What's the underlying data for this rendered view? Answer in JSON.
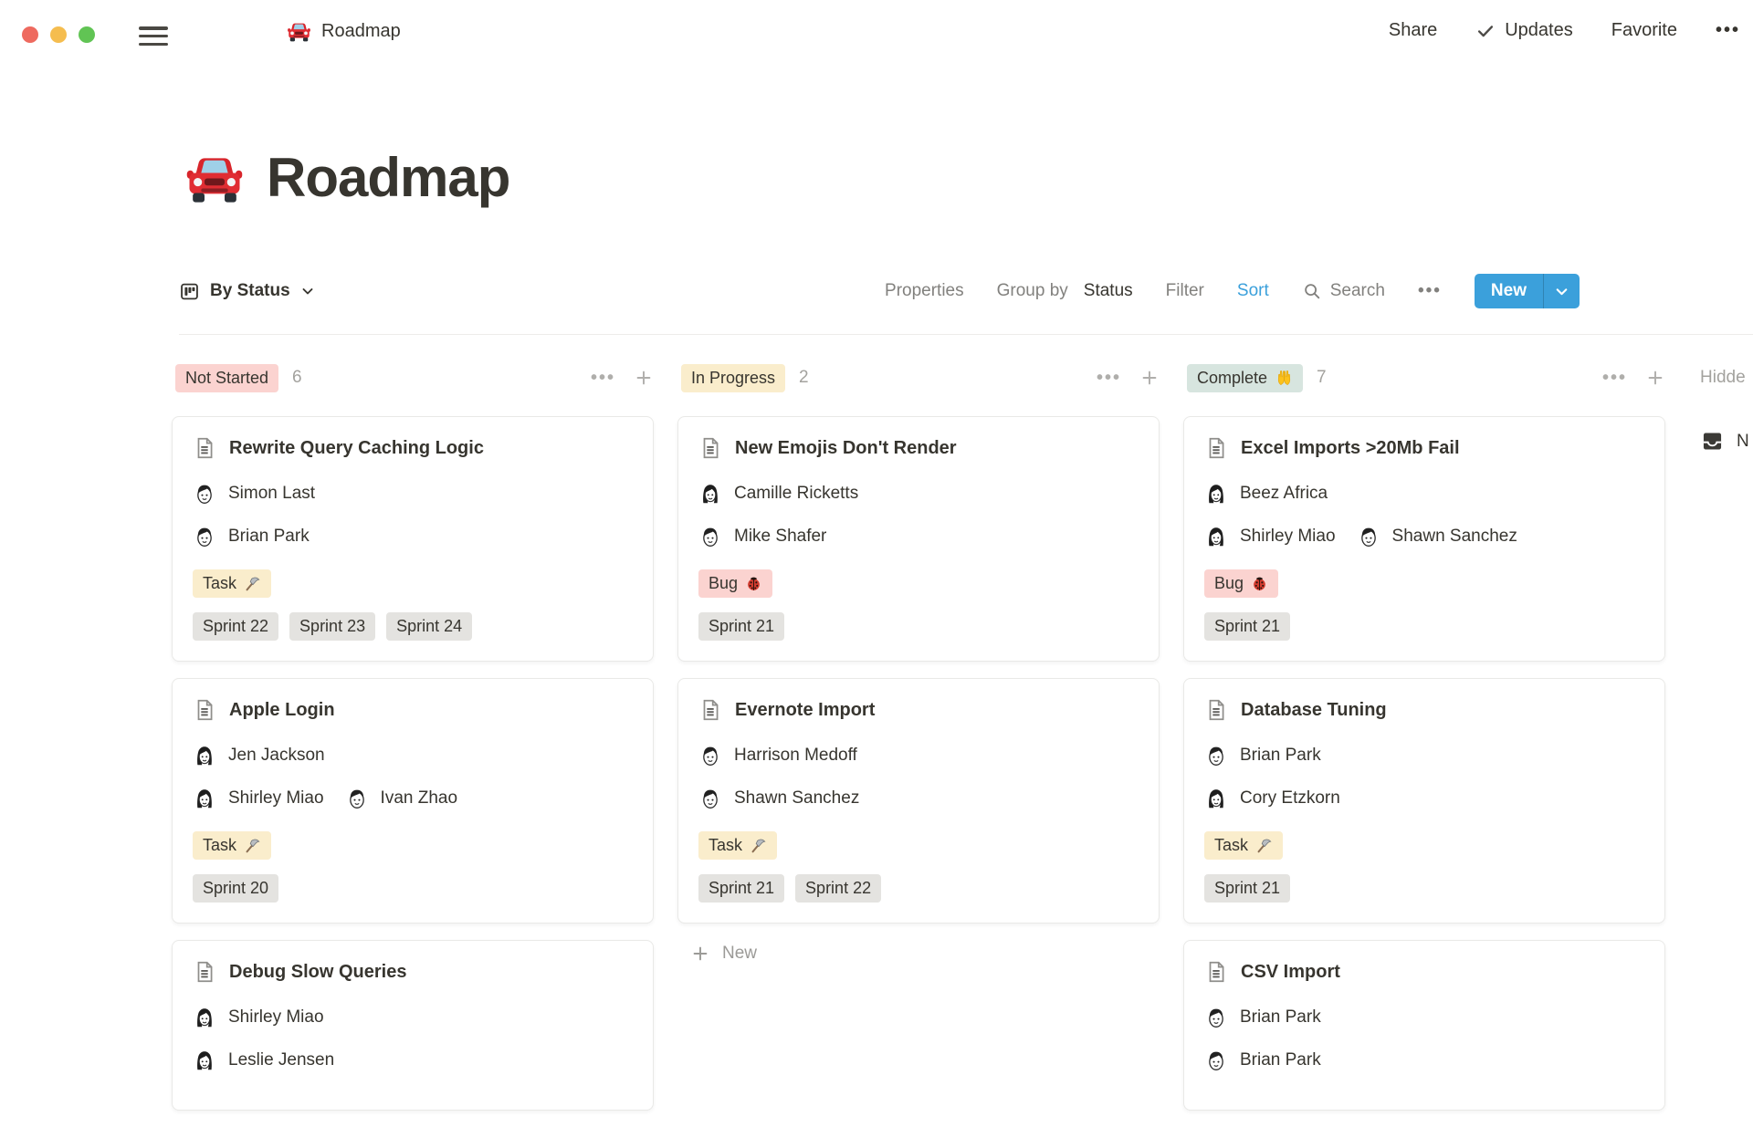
{
  "topbar": {
    "doc_title": "Roadmap",
    "doc_icon": "car-emoji",
    "share_label": "Share",
    "updates_label": "Updates",
    "favorite_label": "Favorite",
    "more_label": "•••"
  },
  "page": {
    "title": "Roadmap",
    "title_icon": "car-emoji"
  },
  "toolbar": {
    "view_label": "By Status",
    "properties_label": "Properties",
    "group_by_label": "Group by",
    "group_by_value": "Status",
    "filter_label": "Filter",
    "sort_label": "Sort",
    "search_label": "Search",
    "more_label": "•••",
    "new_label": "New"
  },
  "colors": {
    "accent_blue": "#3BA0DB",
    "status_red": "#FBD3D0",
    "status_yellow": "#FAEDCC",
    "status_green": "#D7E5DF",
    "tag_gray": "#E4E3E0"
  },
  "board": {
    "more_label": "•••",
    "columns": [
      {
        "label": "Not Started",
        "emoji": null,
        "badge_color": "#FBD3D0",
        "count": "6",
        "cards": [
          {
            "title": "Rewrite Query Caching Logic",
            "people_rows": [
              [
                {
                  "name": "Simon Last",
                  "avatar": "short-hair-avatar-icon"
                }
              ],
              [
                {
                  "name": "Brian Park",
                  "avatar": "short-hair-avatar-icon"
                }
              ]
            ],
            "tags": [
              {
                "label": "Task",
                "icon": "hammer-emoji",
                "color": "#FAEDCC"
              }
            ],
            "sprints": [
              "Sprint 22",
              "Sprint 23",
              "Sprint 24"
            ]
          },
          {
            "title": "Apple Login",
            "people_rows": [
              [
                {
                  "name": "Jen Jackson",
                  "avatar": "long-hair-avatar-icon"
                }
              ],
              [
                {
                  "name": "Shirley Miao",
                  "avatar": "long-hair-avatar-icon"
                },
                {
                  "name": "Ivan Zhao",
                  "avatar": "short-hair-avatar-icon"
                }
              ]
            ],
            "tags": [
              {
                "label": "Task",
                "icon": "hammer-emoji",
                "color": "#FAEDCC"
              }
            ],
            "sprints": [
              "Sprint 20"
            ]
          },
          {
            "title": "Debug Slow Queries",
            "people_rows": [
              [
                {
                  "name": "Shirley Miao",
                  "avatar": "long-hair-avatar-icon"
                }
              ],
              [
                {
                  "name": "Leslie Jensen",
                  "avatar": "long-hair-avatar-icon"
                }
              ]
            ],
            "tags": [],
            "sprints": []
          }
        ]
      },
      {
        "label": "In Progress",
        "emoji": null,
        "badge_color": "#FAEDCC",
        "count": "2",
        "footer_new": "New",
        "cards": [
          {
            "title": "New Emojis Don't Render",
            "people_rows": [
              [
                {
                  "name": "Camille Ricketts",
                  "avatar": "long-hair-avatar-icon"
                }
              ],
              [
                {
                  "name": "Mike Shafer",
                  "avatar": "short-hair-avatar-icon"
                }
              ]
            ],
            "tags": [
              {
                "label": "Bug",
                "icon": "ladybug-emoji",
                "color": "#FBD3D0"
              }
            ],
            "sprints": [
              "Sprint 21"
            ]
          },
          {
            "title": "Evernote Import",
            "people_rows": [
              [
                {
                  "name": "Harrison Medoff",
                  "avatar": "short-hair-avatar-icon"
                }
              ],
              [
                {
                  "name": "Shawn Sanchez",
                  "avatar": "short-hair-avatar-icon"
                }
              ]
            ],
            "tags": [
              {
                "label": "Task",
                "icon": "hammer-emoji",
                "color": "#FAEDCC"
              }
            ],
            "sprints": [
              "Sprint 21",
              "Sprint 22"
            ]
          }
        ]
      },
      {
        "label": "Complete",
        "emoji": "raised-hands-emoji",
        "badge_color": "#D7E5DF",
        "count": "7",
        "cards": [
          {
            "title": "Excel Imports >20Mb Fail",
            "people_rows": [
              [
                {
                  "name": "Beez Africa",
                  "avatar": "long-hair-avatar-icon"
                }
              ],
              [
                {
                  "name": "Shirley Miao",
                  "avatar": "long-hair-avatar-icon"
                },
                {
                  "name": "Shawn Sanchez",
                  "avatar": "short-hair-avatar-icon"
                }
              ]
            ],
            "tags": [
              {
                "label": "Bug",
                "icon": "ladybug-emoji",
                "color": "#FBD3D0"
              }
            ],
            "sprints": [
              "Sprint 21"
            ]
          },
          {
            "title": "Database Tuning",
            "people_rows": [
              [
                {
                  "name": "Brian Park",
                  "avatar": "short-hair-avatar-icon"
                }
              ],
              [
                {
                  "name": "Cory Etzkorn",
                  "avatar": "long-hair-avatar-icon"
                }
              ]
            ],
            "tags": [
              {
                "label": "Task",
                "icon": "hammer-emoji",
                "color": "#FAEDCC"
              }
            ],
            "sprints": [
              "Sprint 21"
            ]
          },
          {
            "title": "CSV Import",
            "people_rows": [
              [
                {
                  "name": "Brian Park",
                  "avatar": "short-hair-avatar-icon"
                }
              ],
              [
                {
                  "name": "Brian Park",
                  "avatar": "short-hair-avatar-icon"
                }
              ]
            ],
            "tags": [],
            "sprints": []
          }
        ]
      }
    ],
    "hidden": {
      "header_text": "Hidde",
      "item_icon": "inbox-icon",
      "item_text": "N"
    }
  }
}
